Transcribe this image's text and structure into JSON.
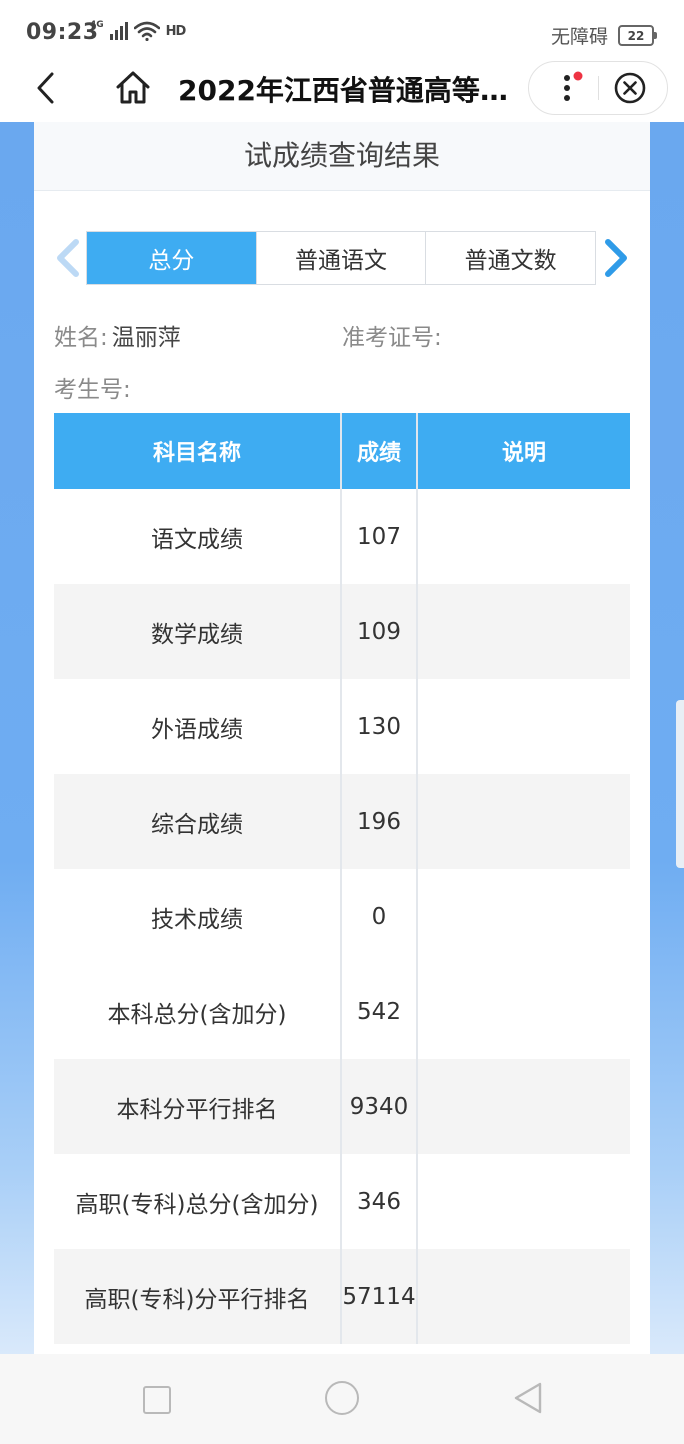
{
  "status_bar": {
    "time": "09:23",
    "network": "4G",
    "hd": "HD",
    "accessibility": "无障碍",
    "battery": "22"
  },
  "nav": {
    "title": "2022年江西省普通高等..."
  },
  "card": {
    "title": "试成绩查询结果"
  },
  "tabs": [
    {
      "label": "总分",
      "active": true
    },
    {
      "label": "普通语文",
      "active": false
    },
    {
      "label": "普通文数",
      "active": false
    }
  ],
  "info": {
    "name_label": "姓名:",
    "name_value": "温丽萍",
    "ticket_label": "准考证号:",
    "ticket_value": "",
    "exam_no_label": "考生号:",
    "exam_no_value": ""
  },
  "table": {
    "headers": [
      "科目名称",
      "成绩",
      "说明"
    ],
    "rows": [
      {
        "subject": "语文成绩",
        "score": "107",
        "note": ""
      },
      {
        "subject": "数学成绩",
        "score": "109",
        "note": ""
      },
      {
        "subject": "外语成绩",
        "score": "130",
        "note": ""
      },
      {
        "subject": "综合成绩",
        "score": "196",
        "note": ""
      },
      {
        "subject": "技术成绩",
        "score": "0",
        "note": ""
      },
      {
        "subject": "本科总分(含加分)",
        "score": "542",
        "note": ""
      },
      {
        "subject": "本科分平行排名",
        "score": "9340",
        "note": ""
      },
      {
        "subject": "高职(专科)总分(含加分)",
        "score": "346",
        "note": ""
      },
      {
        "subject": "高职(专科)分平行排名",
        "score": "57114",
        "note": ""
      }
    ]
  },
  "colors": {
    "accent": "#3eacf2",
    "backdrop": "#6aa8ef",
    "row_alt": "#f4f4f4"
  }
}
